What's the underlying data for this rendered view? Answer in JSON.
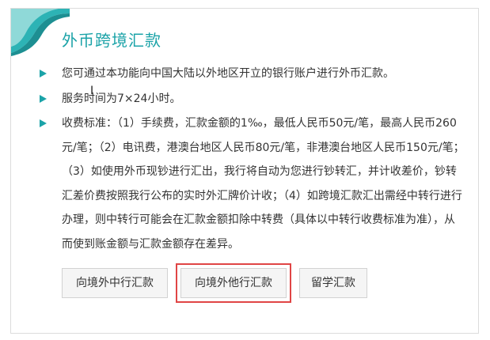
{
  "title": "外币跨境汇款",
  "items": [
    "您可通过本功能向中国大陆以外地区开立的银行账户进行外币汇款。",
    "服务时间为7×24小时。",
    "收费标准：（1）手续费，汇款金额的1‰，最低人民币50元/笔，最高人民币260元/笔；（2）电讯费，港澳台地区人民币80元/笔，非港澳台地区人民币150元/笔；（3）如使用外币现钞进行汇出，我行将自动为您进行钞转汇，并计收差价，钞转汇差价费按照我行公布的实时外汇牌价计收；（4）如跨境汇款汇出需经中转行进行办理，则中转行可能会在汇款金额扣除中转费（具体以中转行收费标准为准），从而使到账金额与汇款金额存在差异。"
  ],
  "buttons": {
    "boc": "向境外中行汇款",
    "other": "向境外他行汇款",
    "study": "留学汇款"
  },
  "colors": {
    "accent": "#1ba3a8",
    "highlight": "#e04545"
  },
  "icons": {
    "bullet": "triangle-right-icon",
    "cursor": "text-cursor-icon"
  }
}
